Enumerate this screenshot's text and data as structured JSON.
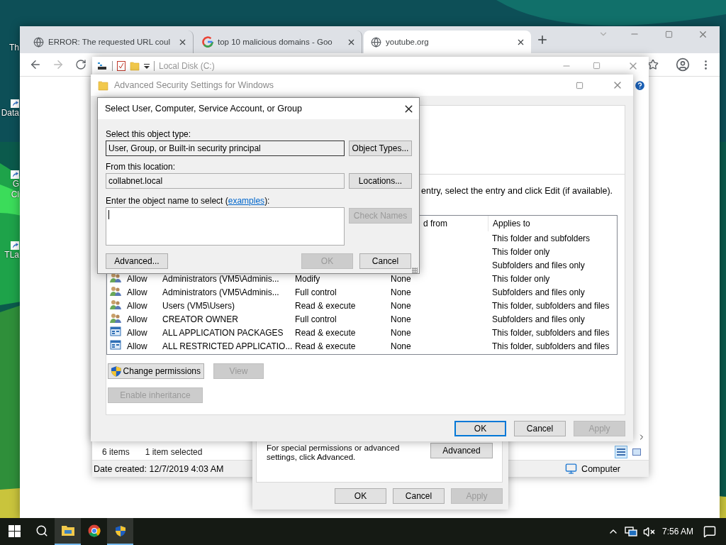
{
  "desktop": {
    "icons": [
      {
        "lines": [
          "Th"
        ]
      },
      {
        "lines": [
          "Data"
        ]
      },
      {
        "lines": [
          "G",
          "Cl"
        ]
      },
      {
        "lines": [
          "TLa"
        ]
      }
    ]
  },
  "browser": {
    "tabs": [
      {
        "title": "ERROR: The requested URL coul",
        "kind": "globe",
        "selected": false
      },
      {
        "title": "top 10 malicious domains - Goo",
        "kind": "google",
        "selected": false
      },
      {
        "title": "youtube.org",
        "kind": "globe",
        "selected": true
      }
    ]
  },
  "explorer": {
    "title": "Local Disk (C:)",
    "item_count": "6 items",
    "selection": "1 item selected",
    "date_created": "Date created: 12/7/2019 4:03 AM",
    "location": "Computer"
  },
  "properties": {
    "note": "For special permissions or advanced settings, click Advanced.",
    "advanced_button": "Advanced",
    "buttons": [
      {
        "label": "OK",
        "disabled": false
      },
      {
        "label": "Cancel",
        "disabled": false
      },
      {
        "label": "Apply",
        "disabled": true
      }
    ]
  },
  "advanced_security": {
    "title": "Advanced Security Settings for Windows",
    "intro": "entry, select the entry and click Edit (if available).",
    "columns": [
      {
        "label": "d from"
      },
      {
        "label": "Applies to"
      }
    ],
    "rows": [
      {
        "applies": "This folder and subfolders"
      },
      {
        "applies": "This folder only"
      },
      {
        "applies": "Subfolders and files only"
      },
      {
        "kind": "users",
        "type": "Allow",
        "principal": "Administrators (VM5\\Adminis...",
        "access": "Modify",
        "inherited": "None",
        "applies": "This folder only"
      },
      {
        "kind": "users",
        "type": "Allow",
        "principal": "Administrators (VM5\\Adminis...",
        "access": "Full control",
        "inherited": "None",
        "applies": "Subfolders and files only"
      },
      {
        "kind": "users",
        "type": "Allow",
        "principal": "Users (VM5\\Users)",
        "access": "Read & execute",
        "inherited": "None",
        "applies": "This folder, subfolders and files"
      },
      {
        "kind": "users",
        "type": "Allow",
        "principal": "CREATOR OWNER",
        "access": "Full control",
        "inherited": "None",
        "applies": "Subfolders and files only"
      },
      {
        "kind": "package",
        "type": "Allow",
        "principal": "ALL APPLICATION PACKAGES",
        "access": "Read & execute",
        "inherited": "None",
        "applies": "This folder, subfolders and files"
      },
      {
        "kind": "package",
        "type": "Allow",
        "principal": "ALL RESTRICTED APPLICATIO...",
        "access": "Read & execute",
        "inherited": "None",
        "applies": "This folder, subfolders and files"
      }
    ],
    "action_buttons": [
      {
        "label": "Change permissions",
        "kind": "shield",
        "disabled": false
      },
      {
        "label": "View",
        "kind": "plain",
        "disabled": true
      }
    ],
    "inheritance_button": {
      "label": "Enable inheritance",
      "disabled": true
    },
    "buttons": [
      {
        "label": "OK",
        "disabled": false,
        "default": true
      },
      {
        "label": "Cancel",
        "disabled": false,
        "default": false
      },
      {
        "label": "Apply",
        "disabled": true,
        "default": false
      }
    ]
  },
  "select_dialog": {
    "title": "Select User, Computer, Service Account, or Group",
    "object_type_label": "Select this object type:",
    "object_type": "User, Group, or Built-in security principal",
    "object_types_button": "Object Types...",
    "location_label": "From this location:",
    "location": "collabnet.local",
    "locations_button": "Locations...",
    "name_prompt_before": "Enter the object name to select (",
    "name_link": "examples",
    "name_prompt_after": "):",
    "check_names": {
      "label": "Check Names",
      "disabled": true
    },
    "advanced_button": "Advanced...",
    "buttons": [
      {
        "label": "OK",
        "disabled": true
      },
      {
        "label": "Cancel",
        "disabled": false
      }
    ]
  },
  "taskbar": {
    "apps": [
      {
        "kind": "explorer",
        "running": true
      },
      {
        "kind": "chrome",
        "running": false
      },
      {
        "kind": "shield",
        "running": true
      }
    ],
    "clock": "7:56 AM"
  }
}
